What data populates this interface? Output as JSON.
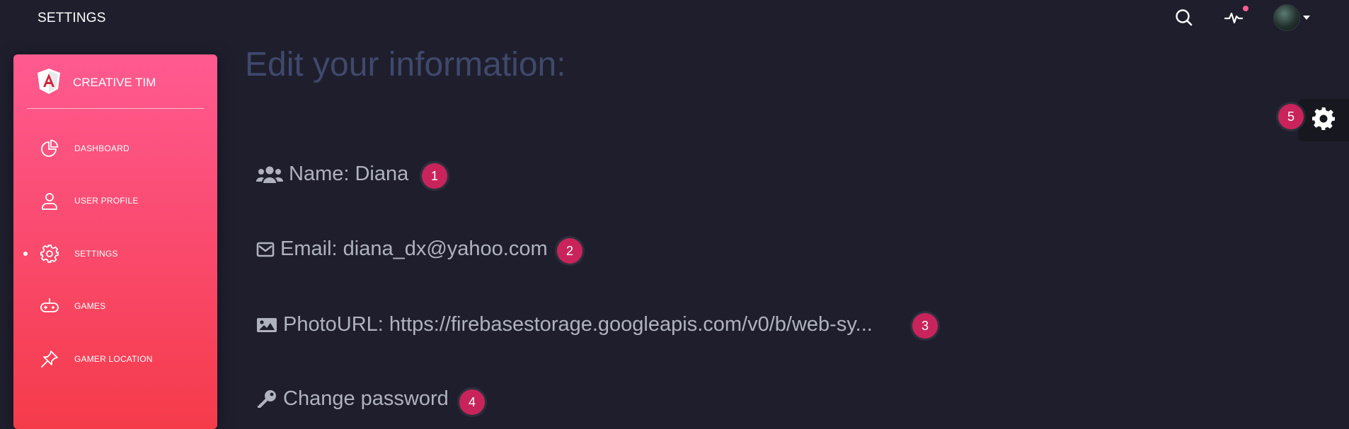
{
  "header": {
    "title": "SETTINGS",
    "icons": {
      "search": "search-icon",
      "activity": "activity-icon",
      "avatar": "avatar"
    },
    "notification_color": "#fd5d93"
  },
  "sidebar": {
    "brand": "CREATIVE TIM",
    "logo": "angular-logo-icon",
    "gradient": [
      "#ff5a91",
      "#f53b4a"
    ],
    "items": [
      {
        "label": "DASHBOARD",
        "icon": "chart-pie-icon",
        "active": false
      },
      {
        "label": "USER PROFILE",
        "icon": "user-icon",
        "active": false
      },
      {
        "label": "SETTINGS",
        "icon": "gear-icon",
        "active": true
      },
      {
        "label": "GAMES",
        "icon": "gamepad-icon",
        "active": false
      },
      {
        "label": "GAMER LOCATION",
        "icon": "pin-icon",
        "active": false
      }
    ]
  },
  "main": {
    "title": "Edit your information:",
    "rows": [
      {
        "icon": "users-icon",
        "text": "Name: Diana",
        "badge": "1"
      },
      {
        "icon": "envelope-icon",
        "text": "Email: diana_dx@yahoo.com",
        "badge": "2"
      },
      {
        "icon": "image-icon",
        "text": "PhotoURL: https://firebasestorage.googleapis.com/v0/b/web-sy...",
        "badge": "3"
      },
      {
        "icon": "key-icon",
        "text": "Change password",
        "badge": "4"
      }
    ],
    "badge_color": "#c8245b"
  },
  "fixed_plugin": {
    "icon": "gear-icon",
    "badge": "5"
  }
}
